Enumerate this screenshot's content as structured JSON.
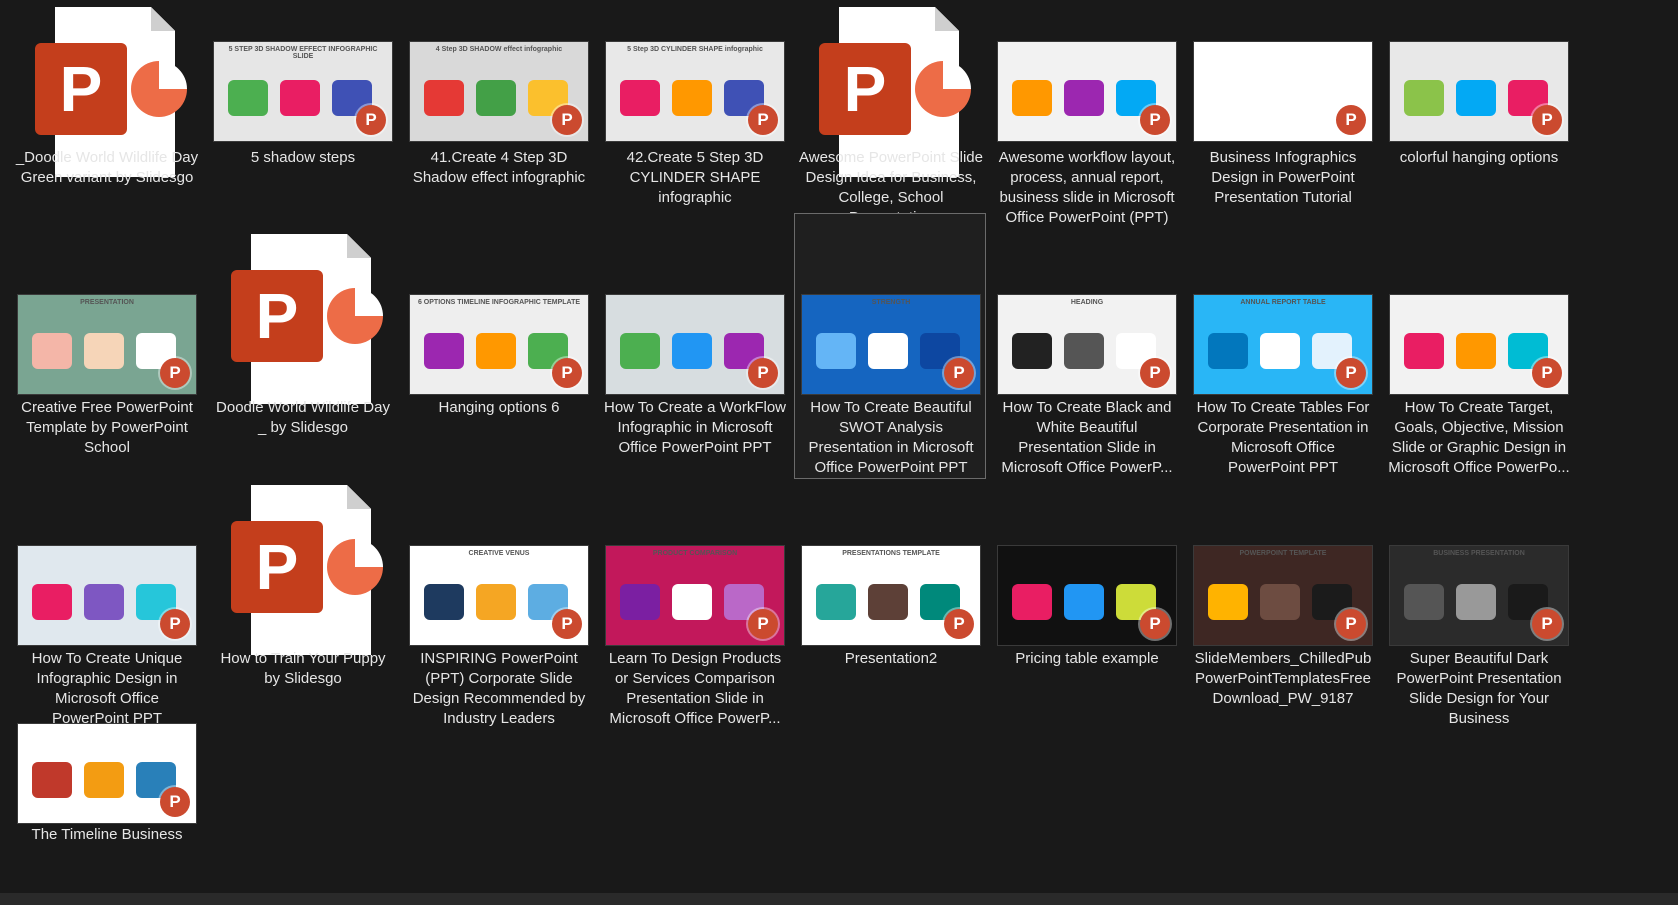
{
  "files": [
    {
      "name": "_Doodle World Wildlife Day Green variant by Slidesgo",
      "icon": "ppt-file-icon",
      "thumb": "",
      "thumb_colors": []
    },
    {
      "name": "5 shadow steps",
      "icon": "thumbnail",
      "thumb": "5 STEP 3D SHADOW EFFECT INFOGRAPHIC SLIDE",
      "thumb_colors": [
        "#e6e6e6",
        "#4caf50",
        "#e91e63",
        "#3f51b5"
      ]
    },
    {
      "name": "41.Create 4 Step 3D Shadow effect infographic",
      "icon": "thumbnail",
      "thumb": "4 Step 3D SHADOW effect infographic",
      "thumb_colors": [
        "#d9d9d9",
        "#e53935",
        "#43a047",
        "#fbc02d"
      ]
    },
    {
      "name": "42.Create 5 Step 3D CYLINDER SHAPE infographic",
      "icon": "thumbnail",
      "thumb": "5 Step 3D CYLINDER SHAPE infographic",
      "thumb_colors": [
        "#e8e8e8",
        "#e91e63",
        "#ff9800",
        "#3f51b5"
      ]
    },
    {
      "name": "Awesome PowerPoint Slide Design Idea for Business, College, School Presentation",
      "icon": "ppt-file-icon",
      "thumb": "",
      "thumb_colors": []
    },
    {
      "name": "Awesome workflow layout, process, annual report, business slide in Microsoft Office PowerPoint (PPT)",
      "icon": "thumbnail",
      "thumb": "",
      "thumb_colors": [
        "#f2f2f2",
        "#ff9800",
        "#9c27b0",
        "#03a9f4"
      ]
    },
    {
      "name": "Business Infographics Design in PowerPoint Presentation Tutorial",
      "icon": "thumbnail",
      "thumb": "",
      "thumb_colors": [
        "#ffffff",
        "#ffffff",
        "#ffffff",
        "#ffffff"
      ]
    },
    {
      "name": "colorful hanging options",
      "icon": "thumbnail",
      "thumb": "",
      "thumb_colors": [
        "#e8e8e8",
        "#8bc34a",
        "#03a9f4",
        "#e91e63"
      ]
    },
    {
      "name": "Creative Free PowerPoint Template by PowerPoint School",
      "icon": "thumbnail",
      "thumb": "PRESENTATION",
      "thumb_colors": [
        "#7aa592",
        "#f4b6a8",
        "#f6d5b8",
        "#ffffff"
      ]
    },
    {
      "name": "Doodle World Wildlife Day _ by Slidesgo",
      "icon": "ppt-file-icon",
      "thumb": "",
      "thumb_colors": []
    },
    {
      "name": "Hanging options 6",
      "icon": "thumbnail",
      "thumb": "6 OPTIONS TIMELINE INFOGRAPHIC TEMPLATE",
      "thumb_colors": [
        "#eeeeee",
        "#9c27b0",
        "#ff9800",
        "#4caf50"
      ]
    },
    {
      "name": "How To Create a WorkFlow Infographic in Microsoft Office PowerPoint PPT",
      "icon": "thumbnail",
      "thumb": "",
      "thumb_colors": [
        "#d7dde0",
        "#4caf50",
        "#2196f3",
        "#9c27b0"
      ]
    },
    {
      "name": "How To Create Beautiful SWOT Analysis Presentation in Microsoft Office PowerPoint PPT",
      "icon": "thumbnail",
      "thumb": "STRENGTH",
      "thumb_colors": [
        "#1565c0",
        "#64b5f6",
        "#ffffff",
        "#0d47a1"
      ]
    },
    {
      "name": "How To Create Black and White Beautiful Presentation Slide in Microsoft Office PowerP...",
      "icon": "thumbnail",
      "thumb": "HEADING",
      "thumb_colors": [
        "#f2f2f2",
        "#222222",
        "#555555",
        "#ffffff"
      ]
    },
    {
      "name": "How To Create Tables For Corporate Presentation in Microsoft Office PowerPoint PPT",
      "icon": "thumbnail",
      "thumb": "ANNUAL REPORT TABLE",
      "thumb_colors": [
        "#29b6f6",
        "#0277bd",
        "#ffffff",
        "#e3f2fd"
      ]
    },
    {
      "name": "How To Create Target, Goals, Objective, Mission Slide or Graphic Design in Microsoft Office PowerPo...",
      "icon": "thumbnail",
      "thumb": "",
      "thumb_colors": [
        "#f2f2f2",
        "#e91e63",
        "#ff9800",
        "#00bcd4"
      ]
    },
    {
      "name": "How To Create Unique Infographic Design in Microsoft Office PowerPoint PPT",
      "icon": "thumbnail",
      "thumb": "",
      "thumb_colors": [
        "#e0e8ee",
        "#e91e63",
        "#7e57c2",
        "#26c6da"
      ]
    },
    {
      "name": "How to Train Your Puppy by Slidesgo",
      "icon": "ppt-file-icon",
      "thumb": "",
      "thumb_colors": []
    },
    {
      "name": "INSPIRING PowerPoint (PPT) Corporate Slide Design Recommended by Industry Leaders",
      "icon": "thumbnail",
      "thumb": "CREATIVE VENUS",
      "thumb_colors": [
        "#ffffff",
        "#1e3a5f",
        "#f5a623",
        "#5dade2"
      ]
    },
    {
      "name": "Learn To Design Products or Services Comparison Presentation Slide in Microsoft Office PowerP...",
      "icon": "thumbnail",
      "thumb": "PRODUCT COMPARISON",
      "thumb_colors": [
        "#c2185b",
        "#7b1fa2",
        "#ffffff",
        "#ba68c8"
      ]
    },
    {
      "name": "Presentation2",
      "icon": "thumbnail",
      "thumb": "PRESENTATIONS TEMPLATE",
      "thumb_colors": [
        "#ffffff",
        "#26a69a",
        "#5d4037",
        "#00897b"
      ]
    },
    {
      "name": "Pricing table example",
      "icon": "thumbnail",
      "thumb": "",
      "thumb_colors": [
        "#111111",
        "#e91e63",
        "#2196f3",
        "#cddc39"
      ]
    },
    {
      "name": "SlideMembers_ChilledPubPowerPointTemplatesFreeDownload_PW_9187",
      "icon": "thumbnail",
      "thumb": "POWERPOINT TEMPLATE",
      "thumb_colors": [
        "#3e2723",
        "#ffb300",
        "#6d4c41",
        "#1b1b1b"
      ]
    },
    {
      "name": "Super Beautiful Dark PowerPoint Presentation Slide Design for Your Business",
      "icon": "thumbnail",
      "thumb": "BUSINESS PRESENTATION",
      "thumb_colors": [
        "#2b2b2b",
        "#555555",
        "#999999",
        "#1a1a1a"
      ]
    },
    {
      "name": "The Timeline Business",
      "icon": "thumbnail",
      "thumb": "",
      "thumb_colors": [
        "#ffffff",
        "#c0392b",
        "#f39c12",
        "#2980b9"
      ]
    }
  ],
  "selected_index": 12,
  "badge_letter": "P",
  "accent": "#c43e1c"
}
